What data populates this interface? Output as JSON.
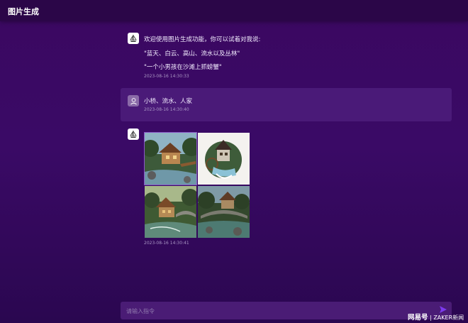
{
  "header": {
    "title": "图片生成"
  },
  "messages": [
    {
      "role": "bot",
      "lines": [
        "欢迎使用图片生成功能，你可以试着对我说:",
        "\"蓝天、白云、高山、流水以及丛林\"",
        "\"一个小男孩在沙滩上抓螃蟹\""
      ],
      "time": "2023-08-16 14:30:33"
    },
    {
      "role": "user",
      "text": "小桥、流水、人家",
      "time": "2023-08-16 14:30:40"
    },
    {
      "role": "bot",
      "images": [
        "cottage-by-stream",
        "watermill-house-sticker",
        "cottage-with-bridge",
        "stone-bridge-cottage"
      ],
      "time": "2023-08-16 14:30:41"
    }
  ],
  "input": {
    "placeholder": "请输入指令"
  },
  "icons": {
    "bot": "sailboat-icon",
    "user": "user-icon",
    "send": "send-icon"
  },
  "watermark": {
    "brand": "网易号",
    "divider": "|",
    "source": "ZAKER新闻"
  },
  "colors": {
    "accent": "#7c3aed",
    "background": "#3a0a66"
  }
}
